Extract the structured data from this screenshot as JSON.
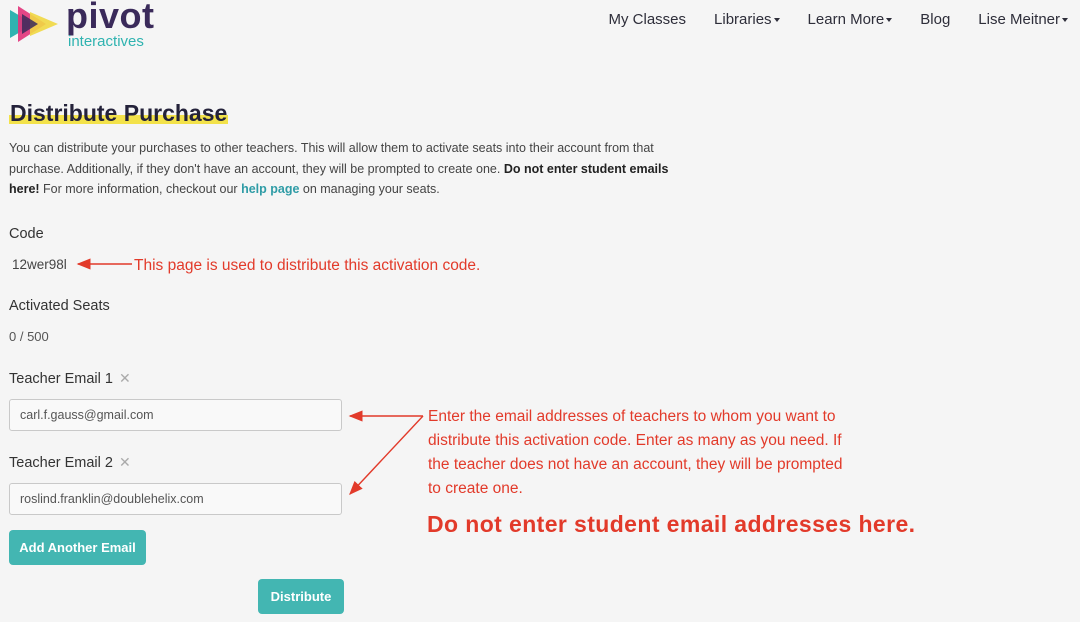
{
  "header": {
    "logo_name": "pivot",
    "logo_sub": "interactives",
    "nav": [
      {
        "label": "My Classes",
        "has_caret": false
      },
      {
        "label": "Libraries",
        "has_caret": true
      },
      {
        "label": "Learn More",
        "has_caret": true
      },
      {
        "label": "Blog",
        "has_caret": false
      },
      {
        "label": "Lise Meitner",
        "has_caret": true
      }
    ]
  },
  "page": {
    "title": "Distribute Purchase",
    "intro_part1": "You can distribute your purchases to other teachers. This will allow them to activate seats into their account from that purchase. Additionally, if they don't have an account, they will be prompted to create one. ",
    "intro_bold": "Do not enter student emails here!",
    "intro_part2": " For more information, checkout our ",
    "intro_link": "help page",
    "intro_part3": " on managing your seats."
  },
  "code": {
    "label": "Code",
    "value": "12wer98l"
  },
  "seats": {
    "label": "Activated Seats",
    "value": "0 / 500"
  },
  "emails": [
    {
      "label": "Teacher Email 1",
      "value": "carl.f.gauss@gmail.com"
    },
    {
      "label": "Teacher Email 2",
      "value": "roslind.franklin@doublehelix.com"
    }
  ],
  "buttons": {
    "add_email": "Add Another Email",
    "distribute": "Distribute"
  },
  "annotations": {
    "code_note": "This page is used to distribute this activation code.",
    "email_note_lines": [
      "Enter the email addresses of teachers to whom you want to",
      "distribute this activation code. Enter as many as you need. If",
      "the teacher does not have an account, they will be prompted",
      "to create one."
    ],
    "warning": "Do not enter student email addresses here."
  },
  "colors": {
    "accent": "#43b6b2",
    "annotation": "#e23a2a",
    "highlight": "#f3e24a",
    "brand_dark": "#3a2a5a"
  }
}
